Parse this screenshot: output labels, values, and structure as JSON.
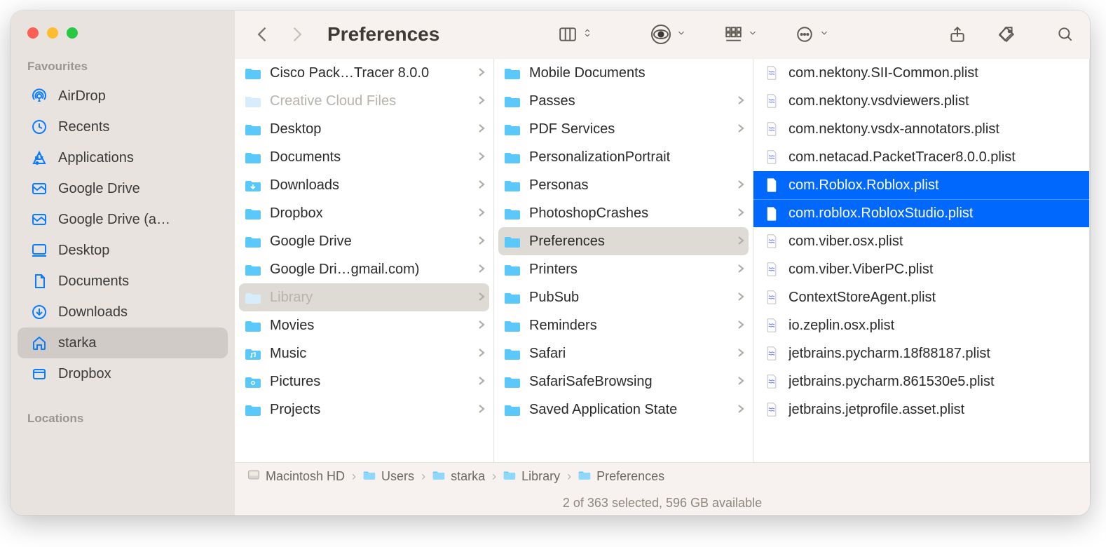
{
  "window_title": "Preferences",
  "sidebar": {
    "sections": [
      {
        "title": "Favourites",
        "items": [
          {
            "icon": "airdrop",
            "label": "AirDrop",
            "active": false
          },
          {
            "icon": "clock",
            "label": "Recents",
            "active": false
          },
          {
            "icon": "apps",
            "label": "Applications",
            "active": false
          },
          {
            "icon": "gdrive",
            "label": "Google Drive",
            "active": false
          },
          {
            "icon": "gdrive",
            "label": "Google Drive (a…",
            "active": false
          },
          {
            "icon": "desktop",
            "label": "Desktop",
            "active": false
          },
          {
            "icon": "doc",
            "label": "Documents",
            "active": false
          },
          {
            "icon": "download",
            "label": "Downloads",
            "active": false
          },
          {
            "icon": "home",
            "label": "starka",
            "active": true
          },
          {
            "icon": "dropbox",
            "label": "Dropbox",
            "active": false
          }
        ]
      },
      {
        "title": "Locations",
        "items": []
      }
    ]
  },
  "columns": {
    "col1": [
      {
        "type": "folder",
        "label": "Cisco Pack…Tracer 8.0.0",
        "chev": true
      },
      {
        "type": "folder",
        "label": "Creative Cloud Files",
        "chev": true,
        "dim": true
      },
      {
        "type": "folder",
        "label": "Desktop",
        "chev": true
      },
      {
        "type": "folder",
        "label": "Documents",
        "chev": true
      },
      {
        "type": "folder-dl",
        "label": "Downloads",
        "chev": true
      },
      {
        "type": "folder",
        "label": "Dropbox",
        "chev": true
      },
      {
        "type": "folder-gd",
        "label": "Google Drive",
        "chev": true
      },
      {
        "type": "folder-gd",
        "label": "Google Dri…gmail.com)",
        "chev": true
      },
      {
        "type": "folder",
        "label": "Library",
        "chev": true,
        "sel": "grey",
        "dim": true
      },
      {
        "type": "folder",
        "label": "Movies",
        "chev": true
      },
      {
        "type": "folder-music",
        "label": "Music",
        "chev": true
      },
      {
        "type": "folder-pic",
        "label": "Pictures",
        "chev": true
      },
      {
        "type": "folder",
        "label": "Projects",
        "chev": true
      }
    ],
    "col2": [
      {
        "type": "folder",
        "label": "Mobile Documents",
        "chev": false
      },
      {
        "type": "folder",
        "label": "Passes",
        "chev": true
      },
      {
        "type": "folder",
        "label": "PDF Services",
        "chev": true
      },
      {
        "type": "folder",
        "label": "PersonalizationPortrait",
        "chev": false
      },
      {
        "type": "folder",
        "label": "Personas",
        "chev": true
      },
      {
        "type": "folder",
        "label": "PhotoshopCrashes",
        "chev": true
      },
      {
        "type": "folder",
        "label": "Preferences",
        "chev": true,
        "sel": "grey"
      },
      {
        "type": "folder",
        "label": "Printers",
        "chev": true
      },
      {
        "type": "folder",
        "label": "PubSub",
        "chev": true
      },
      {
        "type": "folder",
        "label": "Reminders",
        "chev": true
      },
      {
        "type": "folder",
        "label": "Safari",
        "chev": true
      },
      {
        "type": "folder",
        "label": "SafariSafeBrowsing",
        "chev": true
      },
      {
        "type": "folder",
        "label": "Saved Application State",
        "chev": true
      }
    ],
    "col3": [
      {
        "type": "plist",
        "label": "com.nektony.SII-Common.plist"
      },
      {
        "type": "plist",
        "label": "com.nektony.vsdviewers.plist"
      },
      {
        "type": "plist",
        "label": "com.nektony.vsdx-annotators.plist"
      },
      {
        "type": "plist",
        "label": "com.netacad.PacketTracer8.0.0.plist"
      },
      {
        "type": "plist",
        "label": "com.Roblox.Roblox.plist",
        "sel": "blue"
      },
      {
        "type": "plist",
        "label": "com.roblox.RobloxStudio.plist",
        "sel": "blue"
      },
      {
        "type": "plist",
        "label": "com.viber.osx.plist"
      },
      {
        "type": "plist",
        "label": "com.viber.ViberPC.plist"
      },
      {
        "type": "plist",
        "label": "ContextStoreAgent.plist"
      },
      {
        "type": "plist",
        "label": "io.zeplin.osx.plist"
      },
      {
        "type": "plist",
        "label": "jetbrains.pycharm.18f88187.plist"
      },
      {
        "type": "plist",
        "label": "jetbrains.pycharm.861530e5.plist"
      },
      {
        "type": "plist",
        "label": "jetbrains.jetprofile.asset.plist"
      }
    ]
  },
  "pathbar": [
    {
      "icon": "disk",
      "label": "Macintosh HD"
    },
    {
      "icon": "folder",
      "label": "Users"
    },
    {
      "icon": "folder",
      "label": "starka"
    },
    {
      "icon": "folder",
      "label": "Library"
    },
    {
      "icon": "folder",
      "label": "Preferences"
    }
  ],
  "status": "2 of 363 selected, 596 GB available"
}
